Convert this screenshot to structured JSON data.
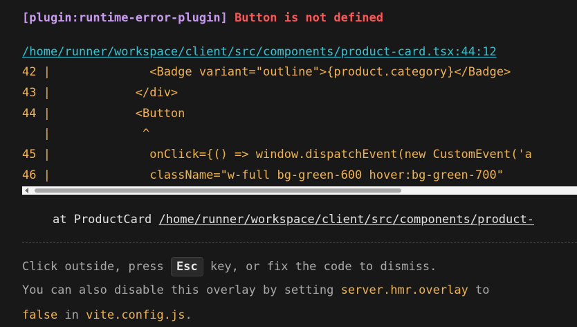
{
  "error": {
    "plugin": "[plugin:runtime-error-plugin]",
    "message": "Button is not defined",
    "file": "/home/runner/workspace/client/src/components/product-card.tsx:44:12"
  },
  "frame": {
    "lines": [
      "42 |              <Badge variant=\"outline\">{product.category}</Badge>",
      "43 |            </div>",
      "44 |            <Button",
      "   |             ^",
      "45 |              onClick={() => window.dispatchEvent(new CustomEvent('a",
      "46 |              className=\"w-full bg-green-600 hover:bg-green-700\""
    ]
  },
  "stack": {
    "prefix": "at ProductCard ",
    "path": "/home/runner/workspace/client/src/components/product-"
  },
  "tip": {
    "line1_before": "Click outside, press ",
    "key": "Esc",
    "line1_after": " key, or fix the code to dismiss.",
    "line2_before": "You can also disable this overlay by setting ",
    "line2_code": "server.hmr.overlay",
    "line2_after": " to",
    "line3_code1": "false",
    "line3_mid": " in ",
    "line3_code2": "vite.config.js",
    "line3_end": "."
  },
  "colors": {
    "background": "#181818",
    "plugin": "#c89bf0",
    "error": "#ff5555",
    "link": "#2ec6d6",
    "code": "#f0b34a"
  }
}
